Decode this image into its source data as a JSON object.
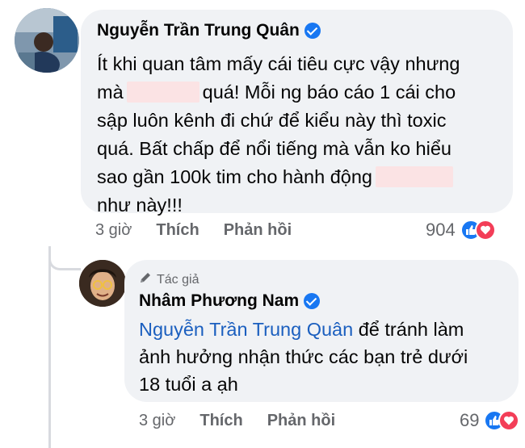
{
  "comment": {
    "author": "Nguyễn Trần Trung Quân",
    "text_lines": [
      "Ít khi quan tâm mấy cái tiêu cực vậy nhưng",
      "quá! Mỗi ng báo cáo 1 cái cho",
      "sập luôn kênh đi chứ để kiểu này thì toxic",
      "quá. Bất chấp để nổi tiếng mà vẫn ko hiểu",
      "sao gần 100k tim cho hành động",
      "như này!!!"
    ],
    "text_prefix_line2": "mà",
    "time": "3 giờ",
    "like_label": "Thích",
    "reply_label": "Phản hồi",
    "reaction_count": "904"
  },
  "reply": {
    "author_badge": "Tác giả",
    "author": "Nhâm Phương Nam",
    "mention": "Nguyễn Trần Trung Quân",
    "text_after_mention": " để tránh làm",
    "text_lines": [
      "ảnh hưởng nhận thức các bạn trẻ dưới",
      "18 tuổi a ạh"
    ],
    "time": "3 giờ",
    "like_label": "Thích",
    "reply_label": "Phản hồi",
    "reaction_count": "69"
  },
  "colors": {
    "bubble": "#f0f2f5",
    "link": "#1b5fbf",
    "meta": "#65676b",
    "like": "#1877f2",
    "love": "#f33e58",
    "redaction": "#fbe3e4"
  },
  "icons": {
    "verified": "verified-badge-icon",
    "author": "pencil-icon",
    "like": "like-icon",
    "love": "love-icon"
  }
}
